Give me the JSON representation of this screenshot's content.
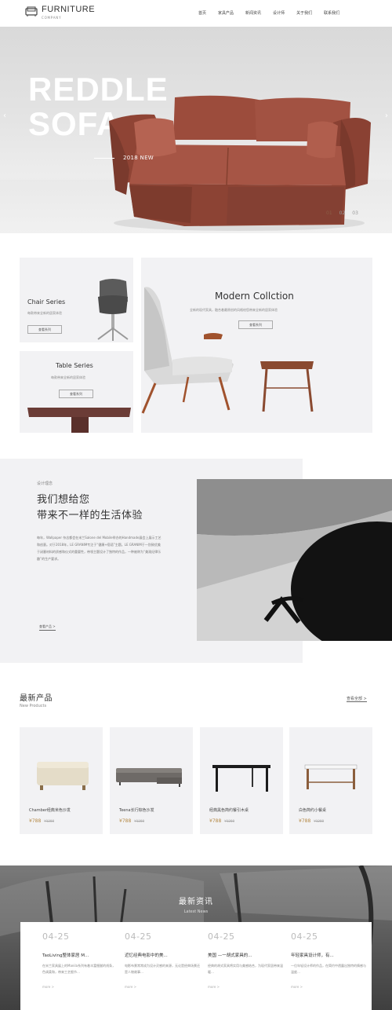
{
  "brand": {
    "name": "FURNITURE",
    "tagline": "COMPANY"
  },
  "nav": [
    "首页",
    "家具产品",
    "新闻资讯",
    "设计师",
    "关于我们",
    "联系我们"
  ],
  "hero": {
    "title_line1": "REDDLE",
    "title_line2": "SOFA",
    "year": "2018 NEW",
    "slides": [
      "01",
      "02",
      "03"
    ],
    "active_slide": 0,
    "prev_arrow": "‹",
    "next_arrow": "›"
  },
  "collection": {
    "chair": {
      "title": "Chair Series",
      "desc": "每款带来全新的居家体验",
      "button": "查看系列"
    },
    "table": {
      "title": "Table Series",
      "desc": "每款带来全新的居家体验",
      "button": "查看系列"
    },
    "modern": {
      "title": "Modern  Collction",
      "desc": "全新的现代家具，融合着最原创的风格给您带来全新的居家体验",
      "button": "查看系列"
    }
  },
  "about": {
    "label": "设计理念",
    "heading_line1": "我们想给您",
    "heading_line2": "带来不一样的生活体验",
    "body": "每年，Wallpaper 杂志都会在米兰Salone del Mobile举办的Handmade展会上展示工艺和创意。对于2018年，LE GRANIM专注于“健康+宿语”主题。LE GRANIM于一别致优美于闭塞材料的质感和仪式的重要性，带领主题设计了独特的作品，一种被称为“美观纪律乐趣”的生产要求。",
    "more": "查看产品 >"
  },
  "products": {
    "title": "最新产品",
    "subtitle": "New Products",
    "see_all": "查看全部 >",
    "items": [
      {
        "name": "Chamber经典米色沙发",
        "price": "¥788",
        "old_price": "¥1288"
      },
      {
        "name": "Teena长行棕色沙发",
        "price": "¥788",
        "old_price": "¥1288"
      },
      {
        "name": "经典黑色简约餐引木桌",
        "price": "¥788",
        "old_price": "¥1288"
      },
      {
        "name": "白色简约小餐桌",
        "price": "¥788",
        "old_price": "¥1288"
      }
    ]
  },
  "news": {
    "title": "最新资讯",
    "subtitle": "Latest News",
    "items": [
      {
        "date": "04-25",
        "headline": "TaoLiving整体家居 M...",
        "excerpt": "在米兰家具展上的Manila系列有着丰富细腻的线条，色调柔和，带来工艺细节…",
        "more": "more >"
      },
      {
        "date": "04-25",
        "headline": "近忆经典电影中的美...",
        "excerpt": "电影布景常常成为设计灵感的来源，无论是经典场景还是人物故事…",
        "more": "more >"
      },
      {
        "date": "04-25",
        "headline": "美国 —一胡式家具的...",
        "excerpt": "经典的胡式家具将实用与美感结合，为现代家居带来温暖…",
        "more": "more >"
      },
      {
        "date": "04-25",
        "headline": "年轻家具设计师，有...",
        "excerpt": "一位年轻设计师的作品，在简约中透露出独特的情感与温度…",
        "more": "more >"
      }
    ]
  },
  "colors": {
    "accent": "#8a5d45",
    "price": "#b58a47",
    "panel": "#f2f2f4"
  }
}
